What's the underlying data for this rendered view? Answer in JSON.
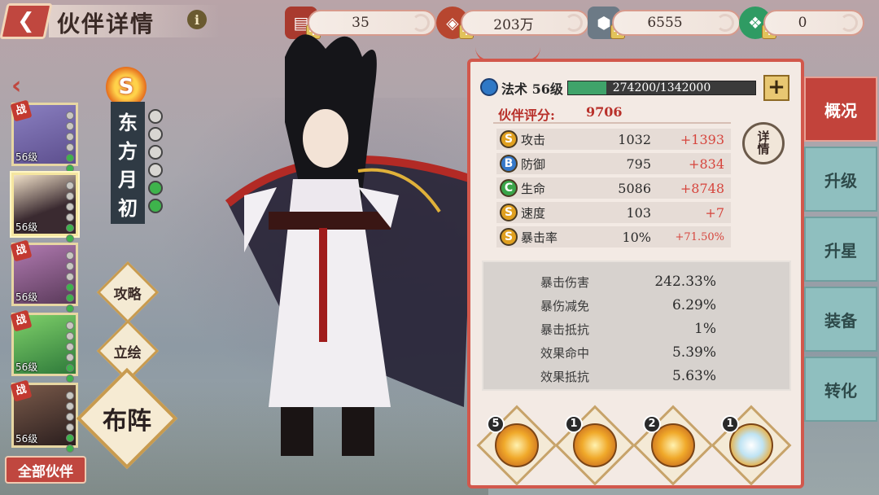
{
  "header": {
    "title": "伙伴详情",
    "info_icon": "i"
  },
  "resources": [
    {
      "name": "scroll",
      "value": "35",
      "color": "#a93a2e",
      "icon": "scroll-icon"
    },
    {
      "name": "coin",
      "value": "203万",
      "color": "#b7462f",
      "icon": "coin-icon"
    },
    {
      "name": "silver",
      "value": "6555",
      "color": "#6c7a86",
      "icon": "silver-icon"
    },
    {
      "name": "jade",
      "value": "0",
      "color": "#2f9b63",
      "icon": "jade-icon"
    }
  ],
  "roster": [
    {
      "level": "56级",
      "battle": "战",
      "color": "#7a6fb0"
    },
    {
      "level": "56级",
      "battle": "",
      "color": "#6b4e58"
    },
    {
      "level": "56级",
      "battle": "战",
      "color": "#8a5a7a"
    },
    {
      "level": "56级",
      "battle": "战",
      "color": "#4e9a58"
    },
    {
      "level": "56级",
      "battle": "战",
      "color": "#5e3e3a"
    }
  ],
  "all_partners_label": "全部伙伴",
  "character": {
    "grade": "S",
    "name_chars": [
      "东",
      "方",
      "月",
      "初"
    ],
    "stars_total": 6,
    "stars_green": 2
  },
  "side_buttons": {
    "strategy": "攻略",
    "portrait": "立绘",
    "deploy": "布阵"
  },
  "panel": {
    "type_level": "法术 56级",
    "exp_text": "274200/1342000",
    "exp_fraction": 0.204,
    "add_label": "+",
    "rating_label": "伙伴评分:",
    "rating_value": "9706",
    "detail_label_top": "详",
    "detail_label_bottom": "情",
    "stats": [
      {
        "icon": "S",
        "icon_color": "#e0a020",
        "name": "攻击",
        "base": "1032",
        "bonus": "+1393",
        "small": false
      },
      {
        "icon": "B",
        "icon_color": "#3578c9",
        "name": "防御",
        "base": "795",
        "bonus": "+834",
        "small": false
      },
      {
        "icon": "C",
        "icon_color": "#3aa54a",
        "name": "生命",
        "base": "5086",
        "bonus": "+8748",
        "small": false
      },
      {
        "icon": "S",
        "icon_color": "#e0a020",
        "name": "速度",
        "base": "103",
        "bonus": "+7",
        "small": false
      },
      {
        "icon": "S",
        "icon_color": "#e0a020",
        "name": "暴击率",
        "base": "10%",
        "bonus": "+71.50%",
        "small": true
      }
    ],
    "sub_stats": [
      {
        "name": "暴击伤害",
        "value": "242.33%"
      },
      {
        "name": "暴伤减免",
        "value": "6.29%"
      },
      {
        "name": "暴击抵抗",
        "value": "1%"
      },
      {
        "name": "效果命中",
        "value": "5.39%"
      },
      {
        "name": "效果抵抗",
        "value": "5.63%"
      }
    ],
    "skills": [
      {
        "count": "5",
        "icon": "fire-orb-icon"
      },
      {
        "count": "1",
        "icon": "flame-fist-icon"
      },
      {
        "count": "2",
        "icon": "golden-sphere-icon"
      },
      {
        "count": "1",
        "icon": "ice-burst-icon"
      }
    ]
  },
  "tabs": [
    "概况",
    "升级",
    "升星",
    "装备",
    "转化"
  ]
}
